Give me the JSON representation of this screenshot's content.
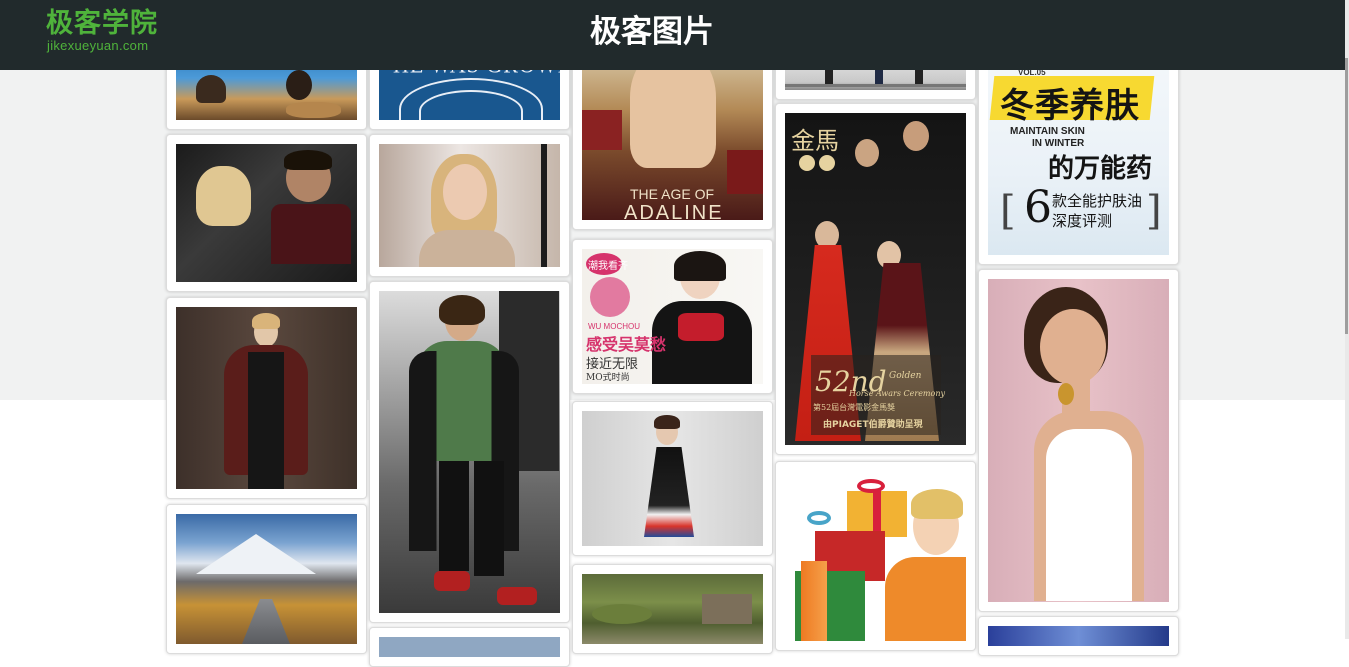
{
  "header": {
    "logo_cn": "极客学院",
    "logo_en": "jikexueyuan.com",
    "title": "极客图片"
  },
  "colors": {
    "header_bg": "#212a2c",
    "logo_green": "#4fb33b",
    "page_bg": "#f1f2f2",
    "card_border": "#dcdcdc"
  },
  "gallery": {
    "images": [
      {
        "name": "couple-guitar",
        "alt": ""
      },
      {
        "name": "he-was-growing-cover",
        "text": "HE WAS GROWING"
      },
      {
        "name": "age-of-adaline-poster",
        "text_a": "THE AGE OF",
        "text_b": "ADALINE"
      },
      {
        "name": "runway-legs",
        "alt": ""
      },
      {
        "name": "winter-skincare-cover",
        "vol": "VOL.05",
        "headline": "冬季养肤",
        "en_a": "MAINTAIN SKIN",
        "en_b": "IN WINTER",
        "sub": "的万能药",
        "num": "6",
        "sub2a": "款全能护肤油",
        "sub2b": "深度评测"
      },
      {
        "name": "couple-in-car",
        "alt": ""
      },
      {
        "name": "blonde-smiling",
        "alt": ""
      },
      {
        "name": "wu-mochou-magazine",
        "badge": "潮我看齐",
        "name_en": "WU MOCHOU",
        "title_cn": "感受吴莫愁",
        "line1": "接近无限",
        "line2": "MO式时尚"
      },
      {
        "name": "golden-horse-ceremony",
        "logo": "金馬",
        "num": "52nd",
        "line1": "Golden",
        "line2": "Horse Awars Ceremony",
        "line3": "第52屆台灣電影金馬獎",
        "footer": "由PIAGET伯爵贊助呈現"
      },
      {
        "name": "coat-model",
        "alt": ""
      },
      {
        "name": "street-style-bomber",
        "alt": ""
      },
      {
        "name": "fringe-dress-runway",
        "alt": ""
      },
      {
        "name": "laughing-woman-earrings",
        "alt": ""
      },
      {
        "name": "snow-mountain-boardwalk",
        "alt": ""
      },
      {
        "name": "landscape-green",
        "alt": ""
      },
      {
        "name": "gifts-girl",
        "alt": ""
      },
      {
        "name": "blue-abstract",
        "alt": ""
      }
    ]
  }
}
